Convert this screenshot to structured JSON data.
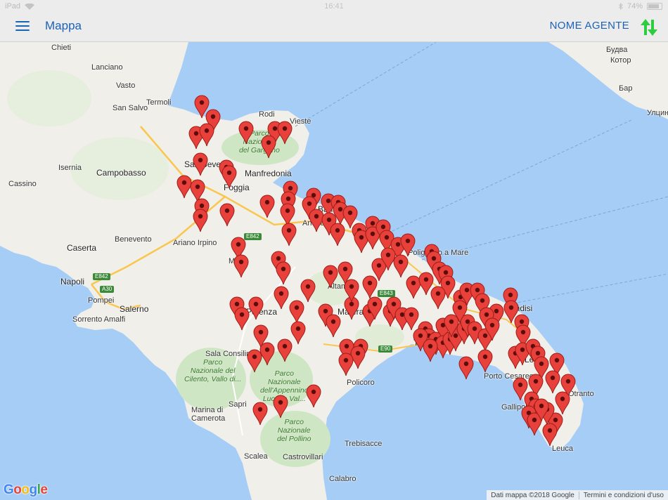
{
  "status_bar": {
    "device": "iPad",
    "time": "16:41",
    "battery": "74%"
  },
  "nav": {
    "title": "Mappa",
    "agent_name": "NOME AGENTE",
    "menu_icon": "hamburger-menu-icon",
    "sync_icon": "sync-arrows-icon",
    "sync_color": "#2ecc40"
  },
  "map": {
    "pin_color": "#e8403a",
    "labels": [
      {
        "id": "chieti",
        "text": "Chieti"
      },
      {
        "id": "lanciano",
        "text": "Lanciano"
      },
      {
        "id": "vasto",
        "text": "Vasto"
      },
      {
        "id": "termoli",
        "text": "Termoli"
      },
      {
        "id": "sansalvo",
        "text": "San Salvo"
      },
      {
        "id": "rodi",
        "text": "Rodi"
      },
      {
        "id": "vieste",
        "text": "Vieste"
      },
      {
        "id": "isernia",
        "text": "Isernia"
      },
      {
        "id": "campobasso",
        "text": "Campobasso"
      },
      {
        "id": "sansevero",
        "text": "San Severo"
      },
      {
        "id": "manfredonia",
        "text": "Manfredonia"
      },
      {
        "id": "cassino",
        "text": "Cassino"
      },
      {
        "id": "foggia",
        "text": "Foggia"
      },
      {
        "id": "benevento",
        "text": "Benevento"
      },
      {
        "id": "ariano",
        "text": "Ariano Irpino"
      },
      {
        "id": "caserta",
        "text": "Caserta"
      },
      {
        "id": "napoli",
        "text": "Napoli"
      },
      {
        "id": "pompei",
        "text": "Pompei"
      },
      {
        "id": "salerno",
        "text": "Salerno"
      },
      {
        "id": "sorrento",
        "text": "Sorrento Amalfi"
      },
      {
        "id": "bari",
        "text": "Bari"
      },
      {
        "id": "andria",
        "text": "Andria"
      },
      {
        "id": "altamura",
        "text": "Altamura"
      },
      {
        "id": "matera",
        "text": "Matera"
      },
      {
        "id": "potenza",
        "text": "Potenza"
      },
      {
        "id": "polignano",
        "text": "Polignano a Mare"
      },
      {
        "id": "brindisi",
        "text": "Brindisi"
      },
      {
        "id": "taranto",
        "text": "Taranto"
      },
      {
        "id": "lecce",
        "text": "Lecce"
      },
      {
        "id": "portocesareo",
        "text": "Porto Cesareo"
      },
      {
        "id": "gallipoli",
        "text": "Gallipoli"
      },
      {
        "id": "otranto",
        "text": "Otranto"
      },
      {
        "id": "leuca",
        "text": "Leuca"
      },
      {
        "id": "policoro",
        "text": "Policoro"
      },
      {
        "id": "salaconsilina",
        "text": "Sala Consilina"
      },
      {
        "id": "sapri",
        "text": "Sapri"
      },
      {
        "id": "marina",
        "text": "Marina di\nCamerota"
      },
      {
        "id": "scalea",
        "text": "Scalea"
      },
      {
        "id": "castrovillari",
        "text": "Castrovillari"
      },
      {
        "id": "trebisacce",
        "text": "Trebisacce"
      },
      {
        "id": "calabro",
        "text": "Calabro"
      },
      {
        "id": "melfi",
        "text": "Melfi"
      },
      {
        "id": "budva",
        "text": "Будва"
      },
      {
        "id": "kotor",
        "text": "Котор"
      },
      {
        "id": "bar",
        "text": "Бар"
      },
      {
        "id": "ulcinj",
        "text": "Улцињ"
      }
    ],
    "parks": [
      {
        "id": "gargano",
        "text": "Parco\nNazionale\ndel Gargano"
      },
      {
        "id": "cilento",
        "text": "Parco\nNazionale del\nCilento, Vallo di..."
      },
      {
        "id": "appennino",
        "text": "Parco\nNazionale\ndell'Appennino\nLucano Val..."
      },
      {
        "id": "pollino",
        "text": "Parco\nNazionale\ndel Pollino"
      }
    ],
    "roads": [
      {
        "id": "e842a",
        "text": "E842"
      },
      {
        "id": "e842b",
        "text": "E842"
      },
      {
        "id": "a30",
        "text": "A30"
      },
      {
        "id": "e843",
        "text": "E843"
      },
      {
        "id": "e90",
        "text": "E90"
      }
    ],
    "google_logo": "Google",
    "attribution": "Dati mappa ©2018 Google",
    "terms": "Termini e condizioni d'uso"
  }
}
